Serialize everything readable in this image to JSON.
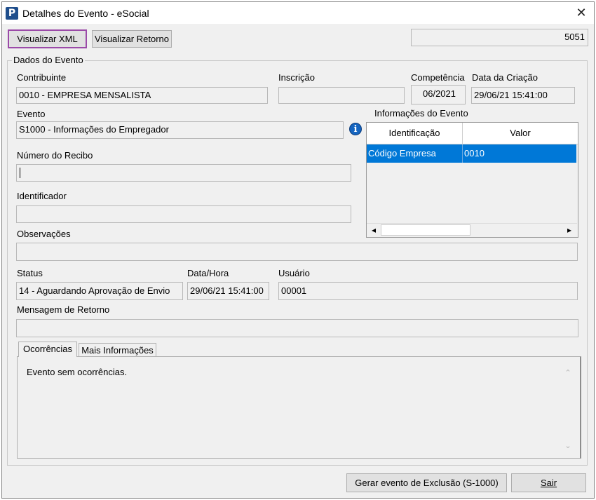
{
  "window": {
    "title": "Detalhes do Evento - eSocial",
    "app_icon": "P"
  },
  "toolbar": {
    "xml_label": "Visualizar XML",
    "retorno_label": "Visualizar Retorno",
    "record_id": "5051"
  },
  "group": {
    "title": "Dados do Evento"
  },
  "contribuinte": {
    "label": "Contribuinte",
    "value": "0010 - EMPRESA MENSALISTA"
  },
  "inscricao": {
    "label": "Inscrição",
    "value": ""
  },
  "competencia": {
    "label": "Competência",
    "value": "06/2021"
  },
  "criacao": {
    "label": "Data da Criação",
    "value": "29/06/21 15:41:00"
  },
  "evento": {
    "label": "Evento",
    "value": "S1000 - Informações do Empregador",
    "info_icon": "i"
  },
  "info_grid": {
    "label": "Informações do Evento",
    "headers": [
      "Identificação",
      "Valor"
    ],
    "rows": [
      {
        "identificacao": "Código Empresa",
        "valor": "0010"
      }
    ]
  },
  "recibo": {
    "label": "Número do Recibo",
    "value": ""
  },
  "identificador": {
    "label": "Identificador",
    "value": ""
  },
  "observacoes": {
    "label": "Observações",
    "value": ""
  },
  "status": {
    "label": "Status",
    "value": "14 - Aguardando Aprovação de Envio"
  },
  "datahora": {
    "label": "Data/Hora",
    "value": "29/06/21 15:41:00"
  },
  "usuario": {
    "label": "Usuário",
    "value": "00001"
  },
  "mensagem": {
    "label": "Mensagem de Retorno",
    "value": ""
  },
  "tabs": [
    {
      "label": "Ocorrências"
    },
    {
      "label": "Mais Informações"
    }
  ],
  "ocorrencias": {
    "text": "Evento sem ocorrências."
  },
  "footer": {
    "exclusao_label": "Gerar evento de Exclusão (S-1000)",
    "sair_label": "Sair"
  },
  "scroll": {
    "left": "◂",
    "right": "▸",
    "up": "⌃",
    "down": "⌄"
  }
}
